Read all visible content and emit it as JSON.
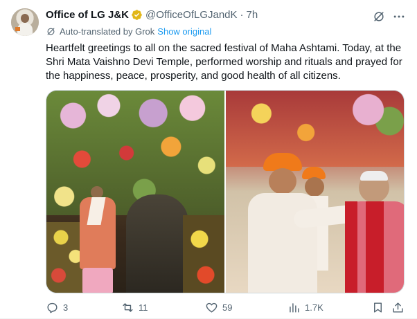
{
  "post": {
    "author_name": "Office of LG J&K",
    "handle": "@OfficeOfLGJandK",
    "separator": "·",
    "time": "7h",
    "translation_note": "Auto-translated by Grok",
    "show_original": "Show original",
    "text": "Heartfelt greetings to all on the sacred festival of Maha Ashtami. Today, at the Shri Mata Vaishno Devi Temple, performed worship and rituals and prayed for the happiness, peace, prosperity, and good health of all citizens.",
    "verified_badge_color": "#e2b719",
    "link_color": "#1d9bf0",
    "icons": {
      "grok": "grok-icon",
      "more": "more-icon",
      "translate": "translate-icon",
      "reply": "reply-icon",
      "repost": "repost-icon",
      "like": "like-icon",
      "views": "views-icon",
      "bookmark": "bookmark-icon",
      "share": "share-icon"
    }
  },
  "metrics": {
    "replies": "3",
    "reposts": "11",
    "likes": "59",
    "views": "1.7K"
  }
}
